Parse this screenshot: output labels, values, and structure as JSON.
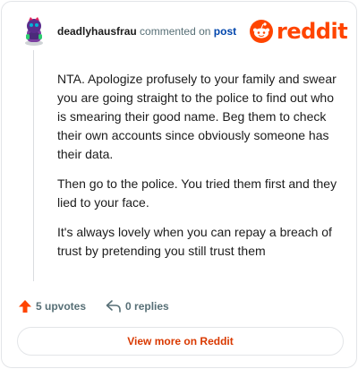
{
  "header": {
    "username": "deadlyhausfrau",
    "action_text": "commented on",
    "post_link": "post",
    "logo_text": "reddit"
  },
  "comment": {
    "paragraphs": [
      "NTA. Apologize profusely to your family and swear you are going straight to the police to find out who is smearing their good name. Beg them to check their own accounts since obviously someone has their data.",
      "Then go to the police. You tried them first and they lied to your face.",
      "It's always lovely when you can repay a breach of trust by pretending you still trust them"
    ]
  },
  "footer": {
    "upvotes": "5 upvotes",
    "replies": "0 replies",
    "view_more": "View more on Reddit"
  },
  "colors": {
    "brand": "#ff4500",
    "upvote": "#ff4500",
    "link": "#0045ac",
    "muted": "#576f76",
    "view_more": "#d93900"
  },
  "icons": {
    "avatar": "snoo-avatar-icon",
    "logo": "reddit-snoo-icon",
    "upvote": "upvote-arrow-icon",
    "reply": "reply-arrow-icon"
  }
}
